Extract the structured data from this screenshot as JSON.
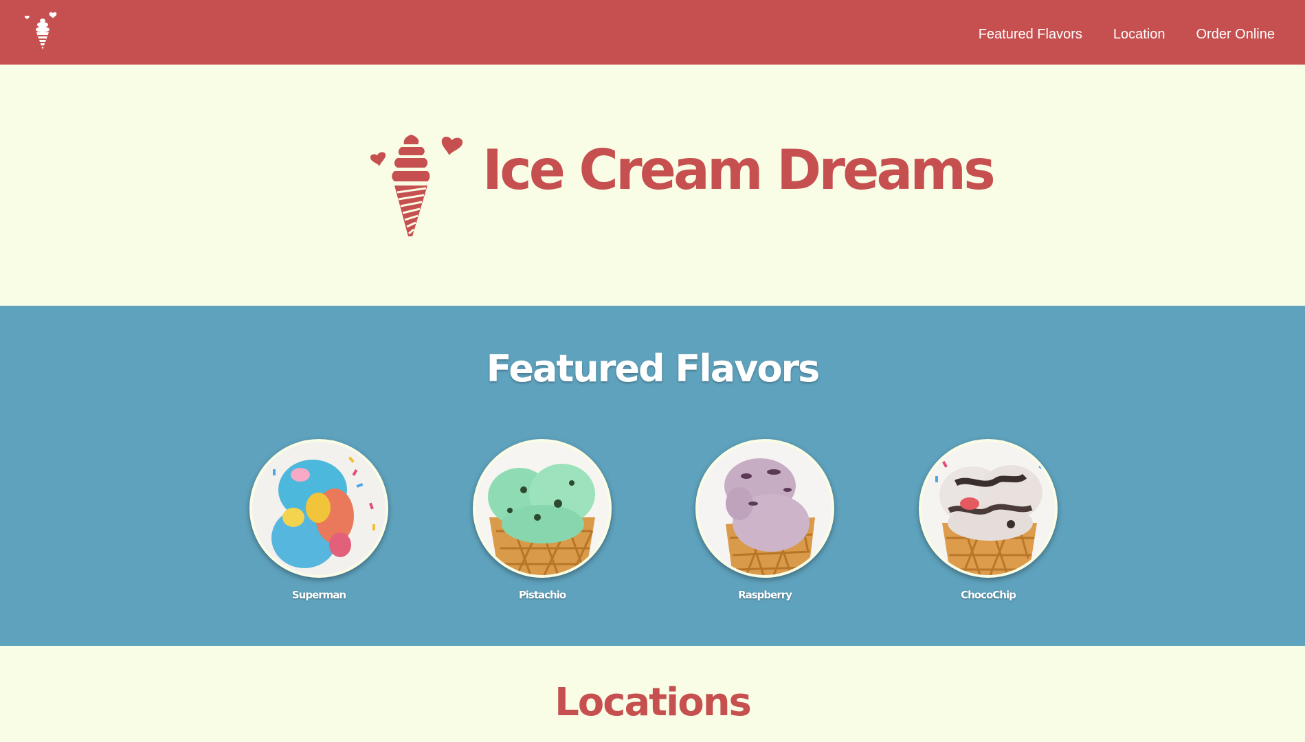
{
  "nav": {
    "logo_icon": "ice-cream-cone-logo-icon",
    "links": [
      "Featured Flavors",
      "Location",
      "Order Online"
    ]
  },
  "hero": {
    "icon": "ice-cream-cone-hearts-icon",
    "title": "Ice Cream Dreams"
  },
  "flavors": {
    "title": "Featured Flavors",
    "items": [
      {
        "name": "Superman"
      },
      {
        "name": "Pistachio"
      },
      {
        "name": "Raspberry"
      },
      {
        "name": "ChocoChip"
      }
    ]
  },
  "locations": {
    "title": "Locations"
  },
  "colors": {
    "brand_red": "#c65050",
    "accent_blue": "#5fa2bd",
    "cream": "#fafde6"
  }
}
